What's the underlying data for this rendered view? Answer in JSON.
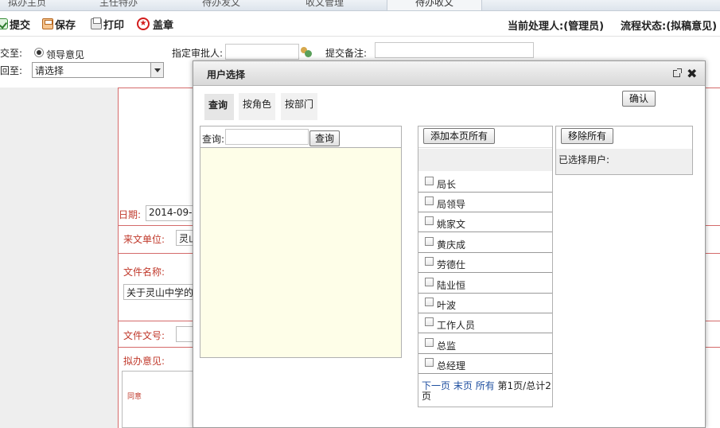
{
  "top_tabs": [
    "拟办主页",
    "主任特办",
    "待办发文",
    "收文管理",
    "待办收文"
  ],
  "toolbar": {
    "submit": "提交",
    "save": "保存",
    "print": "打印",
    "seal": "盖章",
    "handler": "当前处理人:(管理员)",
    "flow_status": "流程状态:(拟稿意见)"
  },
  "form_top": {
    "submit_to_label": "交至:",
    "submit_to_option": "领导意见",
    "assign_approver_label": "指定审批人:",
    "submit_note_label": "提交备注:",
    "return_to_label": "回至:",
    "return_select": "请选择"
  },
  "form": {
    "date_label": "日期:",
    "date_value": "2014-09-",
    "from_unit_label": "来文单位:",
    "from_unit_value": "灵山",
    "file_name_label": "文件名称:",
    "file_name_value": "关于灵山中学的",
    "file_number_label": "文件文号:",
    "opinion_label": "拟办意见:",
    "opinion_text": "同意"
  },
  "modal": {
    "title": "用户选择",
    "tabs": [
      "查询",
      "按角色",
      "按部门"
    ],
    "confirm": "确认",
    "search_label": "查询:",
    "search_value": "",
    "search_button": "查询",
    "add_all": "添加本页所有",
    "remove_all": "移除所有",
    "selected_label": "已选择用户:",
    "users": [
      "局长",
      "局领导",
      "姚家文",
      "黄庆成",
      "劳德仕",
      "陆业恒",
      "叶波",
      "工作人员",
      "总监",
      "总经理"
    ],
    "pager": {
      "next": "下一页",
      "last": "末页",
      "all": "所有",
      "info_line1": "第1页/总计2",
      "info_line2": "页"
    }
  }
}
